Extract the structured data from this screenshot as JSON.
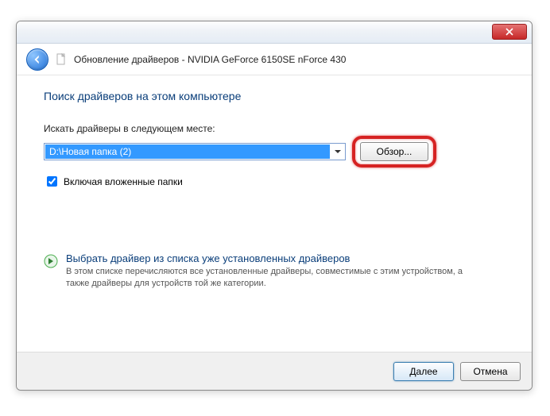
{
  "window": {
    "title": "Обновление драйверов - NVIDIA GeForce 6150SE nForce 430"
  },
  "content": {
    "heading": "Поиск драйверов на этом компьютере",
    "path_label": "Искать драйверы в следующем месте:",
    "path_value": "D:\\Новая папка (2)",
    "browse_label": "Обзор...",
    "include_subfolders_label": "Включая вложенные папки",
    "include_subfolders_checked": true,
    "option_title": "Выбрать драйвер из списка уже установленных драйверов",
    "option_desc": "В этом списке перечисляются все установленные драйверы, совместимые с этим устройством, а также драйверы для устройств той же категории."
  },
  "footer": {
    "next": "Далее",
    "cancel": "Отмена"
  }
}
